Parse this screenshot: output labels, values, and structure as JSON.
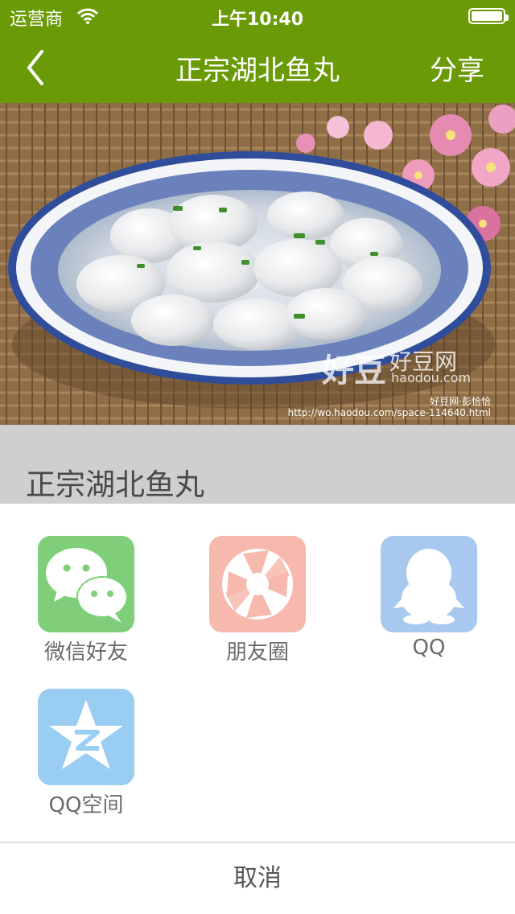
{
  "status_bar": {
    "carrier": "运营商",
    "time": "上午10:40"
  },
  "nav": {
    "title": "正宗湖北鱼丸",
    "share_label": "分享"
  },
  "photo": {
    "watermark_brand": "好豆网",
    "watermark_domain": "haodou.com",
    "watermark_logo_text": "好豆",
    "watermark_credit": "好豆网·彭恰恰",
    "watermark_url": "http://wo.haodou.com/space-114640.html"
  },
  "recipe": {
    "title": "正宗湖北鱼丸"
  },
  "share_sheet": {
    "items": [
      {
        "label": "微信好友",
        "icon": "wechat-icon",
        "color": "#7fcf7a"
      },
      {
        "label": "朋友圈",
        "icon": "moments-icon",
        "color": "#f7b9ad"
      },
      {
        "label": "QQ",
        "icon": "qq-icon",
        "color": "#a9c8ef"
      },
      {
        "label": "QQ空间",
        "icon": "qzone-icon",
        "color": "#99cdf1"
      }
    ],
    "cancel_label": "取消"
  },
  "colors": {
    "brand_green": "#6a9a05",
    "dim_band": "#cfcfcf"
  }
}
